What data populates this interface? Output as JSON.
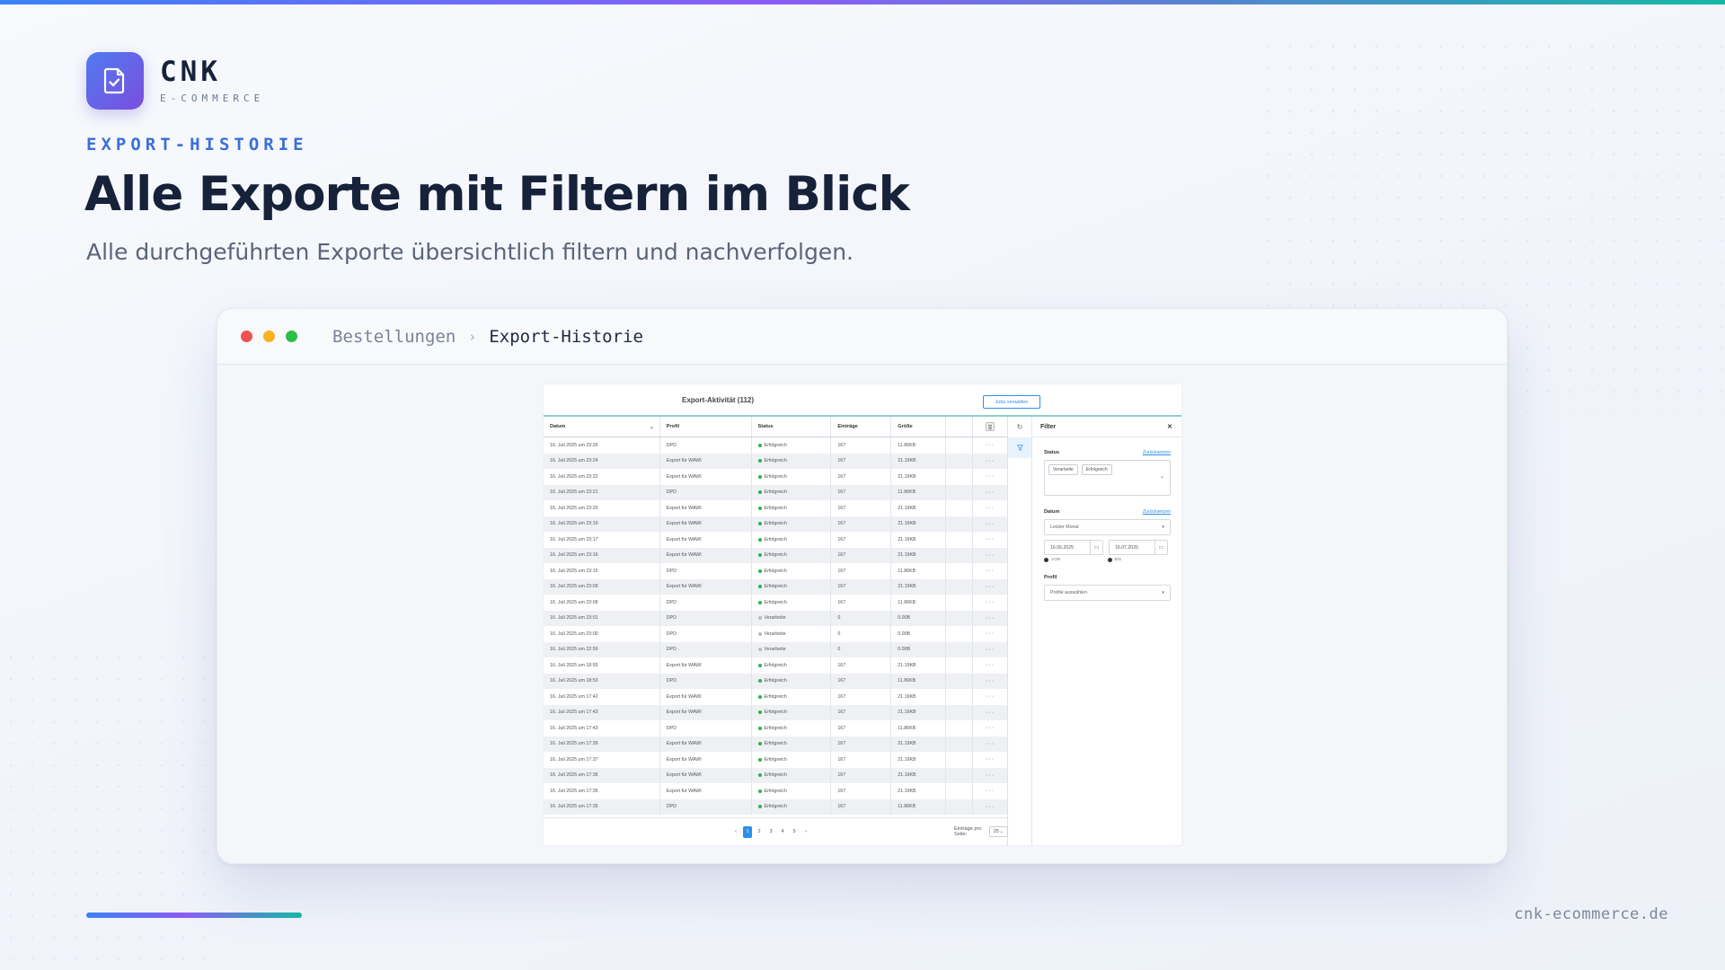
{
  "brand": {
    "name": "CNK",
    "subtitle": "E-COMMERCE"
  },
  "hero": {
    "eyebrow": "EXPORT-HISTORIE",
    "title": "Alle Exporte mit Filtern im Blick",
    "subtitle": "Alle durchgeführten Exporte übersichtlich filtern und nachverfolgen."
  },
  "window": {
    "breadcrumb": {
      "parent": "Bestellungen",
      "current": "Export-Historie"
    }
  },
  "app": {
    "title": "Export-Aktivität (112)",
    "jobs_button": "Jobs verwalten",
    "columns": [
      "Datum",
      "Profil",
      "Status",
      "Einträge",
      "Größe"
    ],
    "status_colors": {
      "Erfolgreich": "#2ab44a",
      "Verarbeite": "#bbbbbb"
    },
    "rows": [
      {
        "date": "16. Juli 2025 um 23:26",
        "profile": "DPD",
        "status": "Erfolgreich",
        "entries": "167",
        "size": "11.86KB"
      },
      {
        "date": "16. Juli 2025 um 23:24",
        "profile": "Export für WAWI",
        "status": "Erfolgreich",
        "entries": "167",
        "size": "21.19KB"
      },
      {
        "date": "16. Juli 2025 um 23:22",
        "profile": "Export für WAWI",
        "status": "Erfolgreich",
        "entries": "167",
        "size": "21.19KB"
      },
      {
        "date": "16. Juli 2025 um 23:21",
        "profile": "DPD",
        "status": "Erfolgreich",
        "entries": "167",
        "size": "11.86KB"
      },
      {
        "date": "16. Juli 2025 um 23:20",
        "profile": "Export für WAWI",
        "status": "Erfolgreich",
        "entries": "167",
        "size": "21.19KB"
      },
      {
        "date": "16. Juli 2025 um 23:19",
        "profile": "Export für WAWI",
        "status": "Erfolgreich",
        "entries": "167",
        "size": "21.19KB"
      },
      {
        "date": "16. Juli 2025 um 23:17",
        "profile": "Export für WAWI",
        "status": "Erfolgreich",
        "entries": "167",
        "size": "21.19KB"
      },
      {
        "date": "16. Juli 2025 um 23:16",
        "profile": "Export für WAWI",
        "status": "Erfolgreich",
        "entries": "167",
        "size": "21.19KB"
      },
      {
        "date": "16. Juli 2025 um 23:15",
        "profile": "DPD",
        "status": "Erfolgreich",
        "entries": "167",
        "size": "11.86KB"
      },
      {
        "date": "16. Juli 2025 um 23:09",
        "profile": "Export für WAWI",
        "status": "Erfolgreich",
        "entries": "167",
        "size": "21.19KB"
      },
      {
        "date": "16. Juli 2025 um 23:09",
        "profile": "DPD",
        "status": "Erfolgreich",
        "entries": "167",
        "size": "11.86KB"
      },
      {
        "date": "16. Juli 2025 um 23:01",
        "profile": "DPD",
        "status": "Verarbeite",
        "entries": "0",
        "size": "0.00B"
      },
      {
        "date": "16. Juli 2025 um 23:00",
        "profile": "DPD",
        "status": "Verarbeite",
        "entries": "0",
        "size": "0.00B"
      },
      {
        "date": "16. Juli 2025 um 22:59",
        "profile": "DPD",
        "status": "Verarbeite",
        "entries": "0",
        "size": "0.00B"
      },
      {
        "date": "16. Juli 2025 um 18:55",
        "profile": "Export für WAWI",
        "status": "Erfolgreich",
        "entries": "167",
        "size": "21.19KB"
      },
      {
        "date": "16. Juli 2025 um 18:53",
        "profile": "DPD",
        "status": "Erfolgreich",
        "entries": "167",
        "size": "11.86KB"
      },
      {
        "date": "16. Juli 2025 um 17:42",
        "profile": "Export für WAWI",
        "status": "Erfolgreich",
        "entries": "167",
        "size": "21.19KB"
      },
      {
        "date": "16. Juli 2025 um 17:43",
        "profile": "Export für WAWI",
        "status": "Erfolgreich",
        "entries": "167",
        "size": "21.19KB"
      },
      {
        "date": "16. Juli 2025 um 17:43",
        "profile": "DPD",
        "status": "Erfolgreich",
        "entries": "167",
        "size": "11.86KB"
      },
      {
        "date": "16. Juli 2025 um 17:39",
        "profile": "Export für WAWI",
        "status": "Erfolgreich",
        "entries": "167",
        "size": "21.19KB"
      },
      {
        "date": "16. Juli 2025 um 17:37",
        "profile": "Export für WAWI",
        "status": "Erfolgreich",
        "entries": "167",
        "size": "21.19KB"
      },
      {
        "date": "16. Juli 2025 um 17:36",
        "profile": "Export für WAWI",
        "status": "Erfolgreich",
        "entries": "167",
        "size": "21.19KB"
      },
      {
        "date": "16. Juli 2025 um 17:35",
        "profile": "Export für WAWI",
        "status": "Erfolgreich",
        "entries": "167",
        "size": "21.19KB"
      },
      {
        "date": "16. Juli 2025 um 17:35",
        "profile": "DPD",
        "status": "Erfolgreich",
        "entries": "167",
        "size": "11.86KB"
      }
    ],
    "row_more": "···",
    "pagination": {
      "prev": "‹",
      "next": "›",
      "pages": [
        "1",
        "2",
        "3",
        "4",
        "5"
      ],
      "active_page": "1",
      "per_page_label": "Einträge pro Seite:",
      "per_page_value": "25"
    },
    "filter": {
      "title": "Filter",
      "status_label": "Status",
      "reset": "Zurücksetzen",
      "status_chips": [
        "Verarbeite",
        "Erfolgreich"
      ],
      "date_label": "Datum",
      "date_range": "Letzter Monat",
      "date_from": "16.06.2025",
      "date_to": "16.07.2025",
      "from_label": "VON",
      "to_label": "BIS",
      "profile_label": "Profil",
      "profile_placeholder": "Profile auswählen"
    }
  },
  "footer": {
    "url": "cnk-ecommerce.de"
  }
}
